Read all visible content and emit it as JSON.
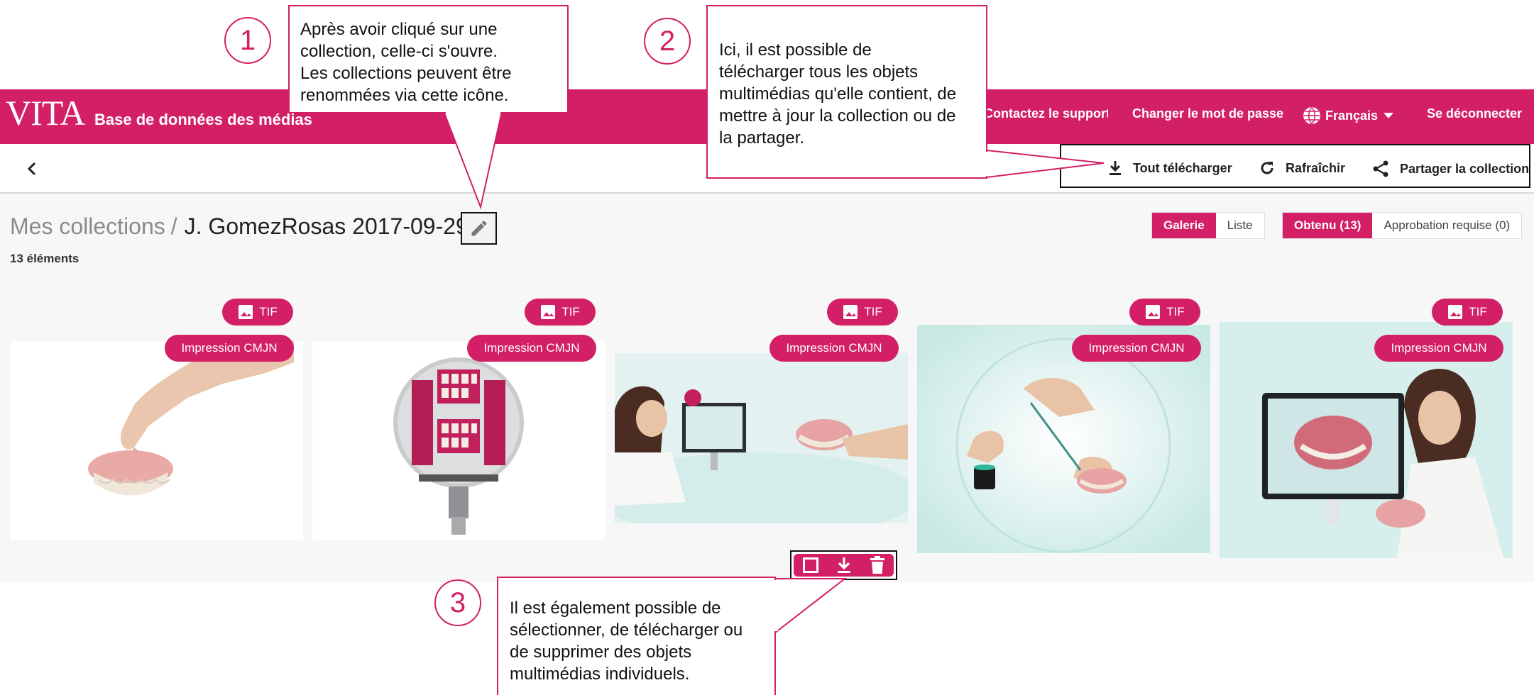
{
  "header": {
    "logo": "VITA",
    "app_title": "Base de données des médias",
    "support_link": "Contactez le support",
    "change_password": "Changer le mot de passe",
    "language": "Français",
    "logout": "Se déconnecter"
  },
  "toolbar": {
    "download_all": "Tout télécharger",
    "refresh": "Rafraîchir",
    "share": "Partager la collection"
  },
  "breadcrumb": {
    "parent": "Mes collections",
    "separator": "/",
    "current": "J. GomezRosas 2017-09-29"
  },
  "item_count": "13 éléments",
  "view_toggle": {
    "gallery": "Galerie",
    "list": "Liste"
  },
  "status_toggle": {
    "obtained": "Obtenu (13)",
    "approval": "Approbation requise (0)"
  },
  "cards": [
    {
      "format": "TIF",
      "print_label": "Impression CMJN",
      "image": "hand-holding-denture-photo"
    },
    {
      "format": "TIF",
      "print_label": "Impression CMJN",
      "image": "shade-device-with-teeth-photo"
    },
    {
      "format": "TIF",
      "print_label": "Impression CMJN",
      "image": "woman-at-computer-with-denture-photo"
    },
    {
      "format": "TIF",
      "print_label": "Impression CMJN",
      "image": "hands-applying-stain-photo"
    },
    {
      "format": "TIF",
      "print_label": "Impression CMJN",
      "image": "woman-at-monitor-with-jaw-photo"
    }
  ],
  "card_action_icons": [
    "checkbox-icon",
    "download-icon",
    "trash-icon"
  ],
  "callouts": [
    {
      "number": "1",
      "lines": [
        "Après avoir cliqué sur une",
        "collection, celle-ci s'ouvre.",
        "Les collections peuvent être",
        "renommées via cette icône."
      ]
    },
    {
      "number": "2",
      "lines": [
        "Ici, il est possible de",
        "télécharger tous les objets",
        "multimédias qu'elle contient, de",
        "mettre à jour la collection ou de",
        "la partager."
      ]
    },
    {
      "number": "3",
      "lines": [
        "Il est également possible de",
        "sélectionner, de télécharger ou",
        "de supprimer des objets",
        "multimédias individuels."
      ]
    }
  ],
  "colors": {
    "brand": "#d31f65",
    "background": "#f7f7f7",
    "text": "#222222"
  }
}
